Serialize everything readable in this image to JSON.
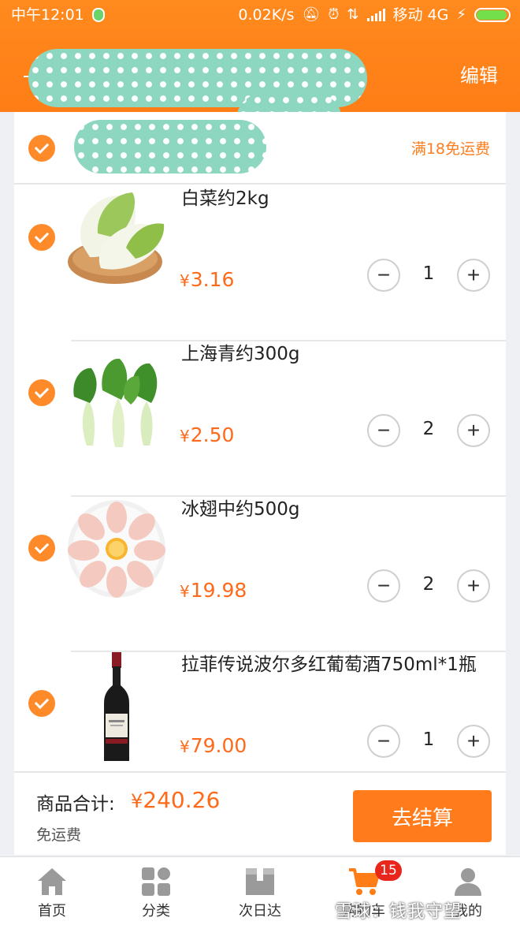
{
  "status_bar": {
    "time": "中午12:01",
    "network_speed": "0.02K/s",
    "carrier": "移动 4G"
  },
  "header": {
    "title": "",
    "edit_label": "编辑"
  },
  "shop": {
    "name": "",
    "shipping_note": "满18免运费"
  },
  "items": [
    {
      "name": "白菜约2kg",
      "currency": "¥",
      "price": "3.16",
      "quantity": "1",
      "image_icon": "napa-cabbage-image"
    },
    {
      "name": "上海青约300g",
      "currency": "¥",
      "price": "2.50",
      "quantity": "2",
      "image_icon": "bok-choy-image"
    },
    {
      "name": "冰翅中约500g",
      "currency": "¥",
      "price": "19.98",
      "quantity": "2",
      "image_icon": "chicken-wings-image"
    },
    {
      "name": "拉菲传说波尔多红葡萄酒750ml*1瓶",
      "currency": "¥",
      "price": "79.00",
      "quantity": "1",
      "image_icon": "red-wine-bottle-image"
    }
  ],
  "qty_controls": {
    "minus": "−",
    "plus": "+"
  },
  "summary": {
    "total_label": "商品合计:",
    "currency": "¥",
    "total": "240.26",
    "shipping_label": "免运费",
    "checkout_label": "去结算"
  },
  "bottom_nav": [
    {
      "label": "首页",
      "icon": "home-icon"
    },
    {
      "label": "分类",
      "icon": "category-grid-icon"
    },
    {
      "label": "次日达",
      "icon": "next-day-box-icon"
    },
    {
      "label": "购物车",
      "icon": "cart-icon",
      "badge": "15"
    },
    {
      "label": "我的",
      "icon": "user-icon"
    }
  ],
  "watermark": "雪球：钱我守望",
  "colors": {
    "accent": "#ff7d16",
    "price": "#ff6a1a",
    "badge": "#e8261b"
  }
}
